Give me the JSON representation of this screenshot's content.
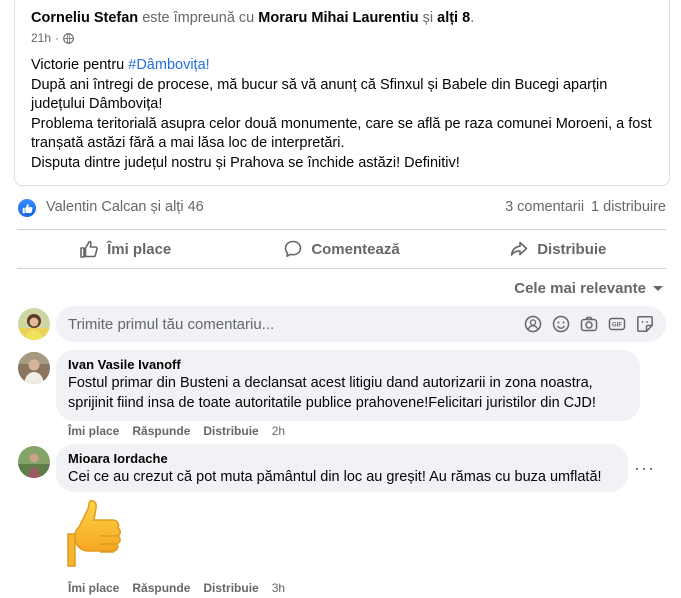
{
  "shared_post": {
    "author": "Corneliu Stefan",
    "with_text": "este împreună cu",
    "tagged": "Moraru Mihai Laurentiu",
    "and_text": "și",
    "others": "alți 8",
    "time": "21h",
    "separator": "·",
    "privacy_icon": "globe-icon",
    "lines": [
      "Victorie pentru",
      "#Dâmbovița!",
      "După ani întregi de procese, mă bucur să vă anunț că Sfinxul și Babele din Bucegi aparțin județului Dâmbovița!",
      "Problema teritorială asupra celor două monumente,  care se află pe raza comunei Moroeni, a fost tranșată astăzi fără a mai lăsa loc de interpretări.",
      "Disputa dintre județul nostru și Prahova se închide astăzi! Definitiv!"
    ]
  },
  "stats": {
    "reactors": "Valentin Calcan și alți 46",
    "comments": "3 comentarii",
    "shares": "1 distribuire"
  },
  "actions": {
    "like": "Îmi place",
    "comment": "Comentează",
    "share": "Distribuie"
  },
  "sort": {
    "label": "Cele mai relevante"
  },
  "composer": {
    "placeholder": "Trimite primul tău comentariu...",
    "icons": [
      "avatar-sticker-icon",
      "emoji-icon",
      "camera-icon",
      "gif-icon",
      "sticker-icon"
    ]
  },
  "comments": [
    {
      "author": "Ivan Vasile Ivanoff",
      "text": "Fostul primar din Busteni a declansat acest litigiu dand autorizarii in zona noastra, sprijinit fiind insa de toate autoritatile publice prahovene!Felicitari juristilor din CJD!",
      "like": "Îmi place",
      "reply": "Răspunde",
      "share": "Distribuie",
      "time": "2h"
    },
    {
      "author": "Mioara Iordache",
      "text": "Cei ce au crezut că pot muta pământul din loc au greșit! Au rămas cu buza umflată!",
      "like": "Îmi place",
      "reply": "Răspunde",
      "share": "Distribuie",
      "time": "3h",
      "more": "···"
    }
  ],
  "colors": {
    "accent": "#216fdb",
    "secondary_text": "#65676b",
    "bubble": "#f0f2f5",
    "like_badge": "#1877f2"
  }
}
